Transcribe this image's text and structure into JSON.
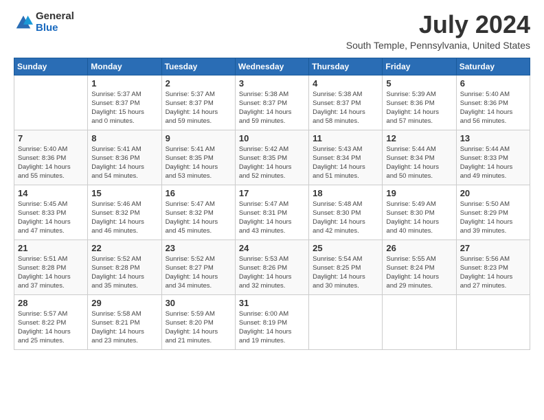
{
  "logo": {
    "general": "General",
    "blue": "Blue"
  },
  "title": "July 2024",
  "location": "South Temple, Pennsylvania, United States",
  "headers": [
    "Sunday",
    "Monday",
    "Tuesday",
    "Wednesday",
    "Thursday",
    "Friday",
    "Saturday"
  ],
  "weeks": [
    [
      {
        "day": "",
        "info": ""
      },
      {
        "day": "1",
        "info": "Sunrise: 5:37 AM\nSunset: 8:37 PM\nDaylight: 15 hours\nand 0 minutes."
      },
      {
        "day": "2",
        "info": "Sunrise: 5:37 AM\nSunset: 8:37 PM\nDaylight: 14 hours\nand 59 minutes."
      },
      {
        "day": "3",
        "info": "Sunrise: 5:38 AM\nSunset: 8:37 PM\nDaylight: 14 hours\nand 59 minutes."
      },
      {
        "day": "4",
        "info": "Sunrise: 5:38 AM\nSunset: 8:37 PM\nDaylight: 14 hours\nand 58 minutes."
      },
      {
        "day": "5",
        "info": "Sunrise: 5:39 AM\nSunset: 8:36 PM\nDaylight: 14 hours\nand 57 minutes."
      },
      {
        "day": "6",
        "info": "Sunrise: 5:40 AM\nSunset: 8:36 PM\nDaylight: 14 hours\nand 56 minutes."
      }
    ],
    [
      {
        "day": "7",
        "info": "Sunrise: 5:40 AM\nSunset: 8:36 PM\nDaylight: 14 hours\nand 55 minutes."
      },
      {
        "day": "8",
        "info": "Sunrise: 5:41 AM\nSunset: 8:36 PM\nDaylight: 14 hours\nand 54 minutes."
      },
      {
        "day": "9",
        "info": "Sunrise: 5:41 AM\nSunset: 8:35 PM\nDaylight: 14 hours\nand 53 minutes."
      },
      {
        "day": "10",
        "info": "Sunrise: 5:42 AM\nSunset: 8:35 PM\nDaylight: 14 hours\nand 52 minutes."
      },
      {
        "day": "11",
        "info": "Sunrise: 5:43 AM\nSunset: 8:34 PM\nDaylight: 14 hours\nand 51 minutes."
      },
      {
        "day": "12",
        "info": "Sunrise: 5:44 AM\nSunset: 8:34 PM\nDaylight: 14 hours\nand 50 minutes."
      },
      {
        "day": "13",
        "info": "Sunrise: 5:44 AM\nSunset: 8:33 PM\nDaylight: 14 hours\nand 49 minutes."
      }
    ],
    [
      {
        "day": "14",
        "info": "Sunrise: 5:45 AM\nSunset: 8:33 PM\nDaylight: 14 hours\nand 47 minutes."
      },
      {
        "day": "15",
        "info": "Sunrise: 5:46 AM\nSunset: 8:32 PM\nDaylight: 14 hours\nand 46 minutes."
      },
      {
        "day": "16",
        "info": "Sunrise: 5:47 AM\nSunset: 8:32 PM\nDaylight: 14 hours\nand 45 minutes."
      },
      {
        "day": "17",
        "info": "Sunrise: 5:47 AM\nSunset: 8:31 PM\nDaylight: 14 hours\nand 43 minutes."
      },
      {
        "day": "18",
        "info": "Sunrise: 5:48 AM\nSunset: 8:30 PM\nDaylight: 14 hours\nand 42 minutes."
      },
      {
        "day": "19",
        "info": "Sunrise: 5:49 AM\nSunset: 8:30 PM\nDaylight: 14 hours\nand 40 minutes."
      },
      {
        "day": "20",
        "info": "Sunrise: 5:50 AM\nSunset: 8:29 PM\nDaylight: 14 hours\nand 39 minutes."
      }
    ],
    [
      {
        "day": "21",
        "info": "Sunrise: 5:51 AM\nSunset: 8:28 PM\nDaylight: 14 hours\nand 37 minutes."
      },
      {
        "day": "22",
        "info": "Sunrise: 5:52 AM\nSunset: 8:28 PM\nDaylight: 14 hours\nand 35 minutes."
      },
      {
        "day": "23",
        "info": "Sunrise: 5:52 AM\nSunset: 8:27 PM\nDaylight: 14 hours\nand 34 minutes."
      },
      {
        "day": "24",
        "info": "Sunrise: 5:53 AM\nSunset: 8:26 PM\nDaylight: 14 hours\nand 32 minutes."
      },
      {
        "day": "25",
        "info": "Sunrise: 5:54 AM\nSunset: 8:25 PM\nDaylight: 14 hours\nand 30 minutes."
      },
      {
        "day": "26",
        "info": "Sunrise: 5:55 AM\nSunset: 8:24 PM\nDaylight: 14 hours\nand 29 minutes."
      },
      {
        "day": "27",
        "info": "Sunrise: 5:56 AM\nSunset: 8:23 PM\nDaylight: 14 hours\nand 27 minutes."
      }
    ],
    [
      {
        "day": "28",
        "info": "Sunrise: 5:57 AM\nSunset: 8:22 PM\nDaylight: 14 hours\nand 25 minutes."
      },
      {
        "day": "29",
        "info": "Sunrise: 5:58 AM\nSunset: 8:21 PM\nDaylight: 14 hours\nand 23 minutes."
      },
      {
        "day": "30",
        "info": "Sunrise: 5:59 AM\nSunset: 8:20 PM\nDaylight: 14 hours\nand 21 minutes."
      },
      {
        "day": "31",
        "info": "Sunrise: 6:00 AM\nSunset: 8:19 PM\nDaylight: 14 hours\nand 19 minutes."
      },
      {
        "day": "",
        "info": ""
      },
      {
        "day": "",
        "info": ""
      },
      {
        "day": "",
        "info": ""
      }
    ]
  ]
}
